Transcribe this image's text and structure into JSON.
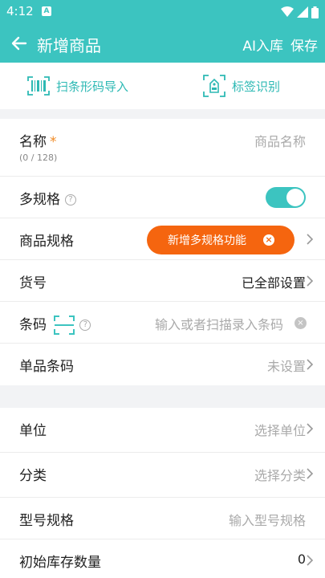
{
  "status": {
    "time": "4:12",
    "notif": "A"
  },
  "toolbar": {
    "title": "新增商品",
    "ai_label": "AI入库",
    "save_label": "保存"
  },
  "tools": {
    "scan_label": "扫条形码导入",
    "tag_label": "标签识别"
  },
  "form": {
    "name": {
      "label": "名称",
      "required": "*",
      "counter": "(0 / 128)",
      "placeholder": "商品名称"
    },
    "multi_spec": {
      "label": "多规格",
      "help": "?",
      "enabled": true
    },
    "spec": {
      "label": "商品规格"
    },
    "sku": {
      "label": "货号",
      "value": "已全部设置"
    },
    "barcode": {
      "label": "条码",
      "help": "?",
      "placeholder": "输入或者扫描录入条码"
    },
    "single_barcode": {
      "label": "单品条码",
      "value": "未设置"
    },
    "unit": {
      "label": "单位",
      "value": "选择单位"
    },
    "category": {
      "label": "分类",
      "value": "选择分类"
    },
    "model": {
      "label": "型号规格",
      "placeholder": "输入型号规格"
    },
    "stock": {
      "label": "初始库存数量",
      "value": "0"
    }
  },
  "tooltip": {
    "text": "新增多规格功能",
    "close": "×"
  },
  "colors": {
    "primary": "#3cc4c0",
    "accent": "#f5650f",
    "required": "#f08a24"
  }
}
